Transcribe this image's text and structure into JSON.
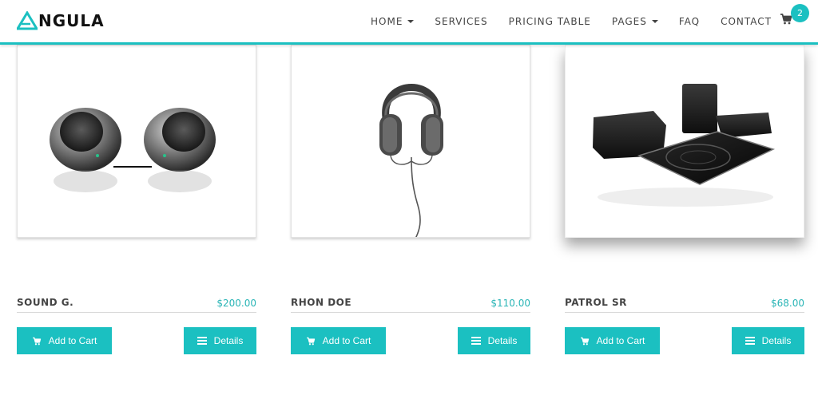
{
  "brand": {
    "name": "NGULA",
    "accent": "#1bc0c1"
  },
  "nav": {
    "items": [
      {
        "label": "HOME",
        "dropdown": true
      },
      {
        "label": "SERVICES",
        "dropdown": false
      },
      {
        "label": "PRICING TABLE",
        "dropdown": false
      },
      {
        "label": "PAGES",
        "dropdown": true
      },
      {
        "label": "FAQ",
        "dropdown": false
      },
      {
        "label": "CONTACT",
        "dropdown": false
      }
    ],
    "cart_icon": "shopping-cart-icon",
    "cart_count": "2"
  },
  "products": [
    {
      "name": "SOUND G.",
      "price": "$200.00",
      "add_label": "Add to Cart",
      "details_label": "Details",
      "image": "speakers-image"
    },
    {
      "name": "RHON DOE",
      "price": "$110.00",
      "add_label": "Add to Cart",
      "details_label": "Details",
      "image": "headphones-image"
    },
    {
      "name": "PATROL SR",
      "price": "$68.00",
      "add_label": "Add to Cart",
      "details_label": "Details",
      "image": "home-theater-image"
    }
  ]
}
